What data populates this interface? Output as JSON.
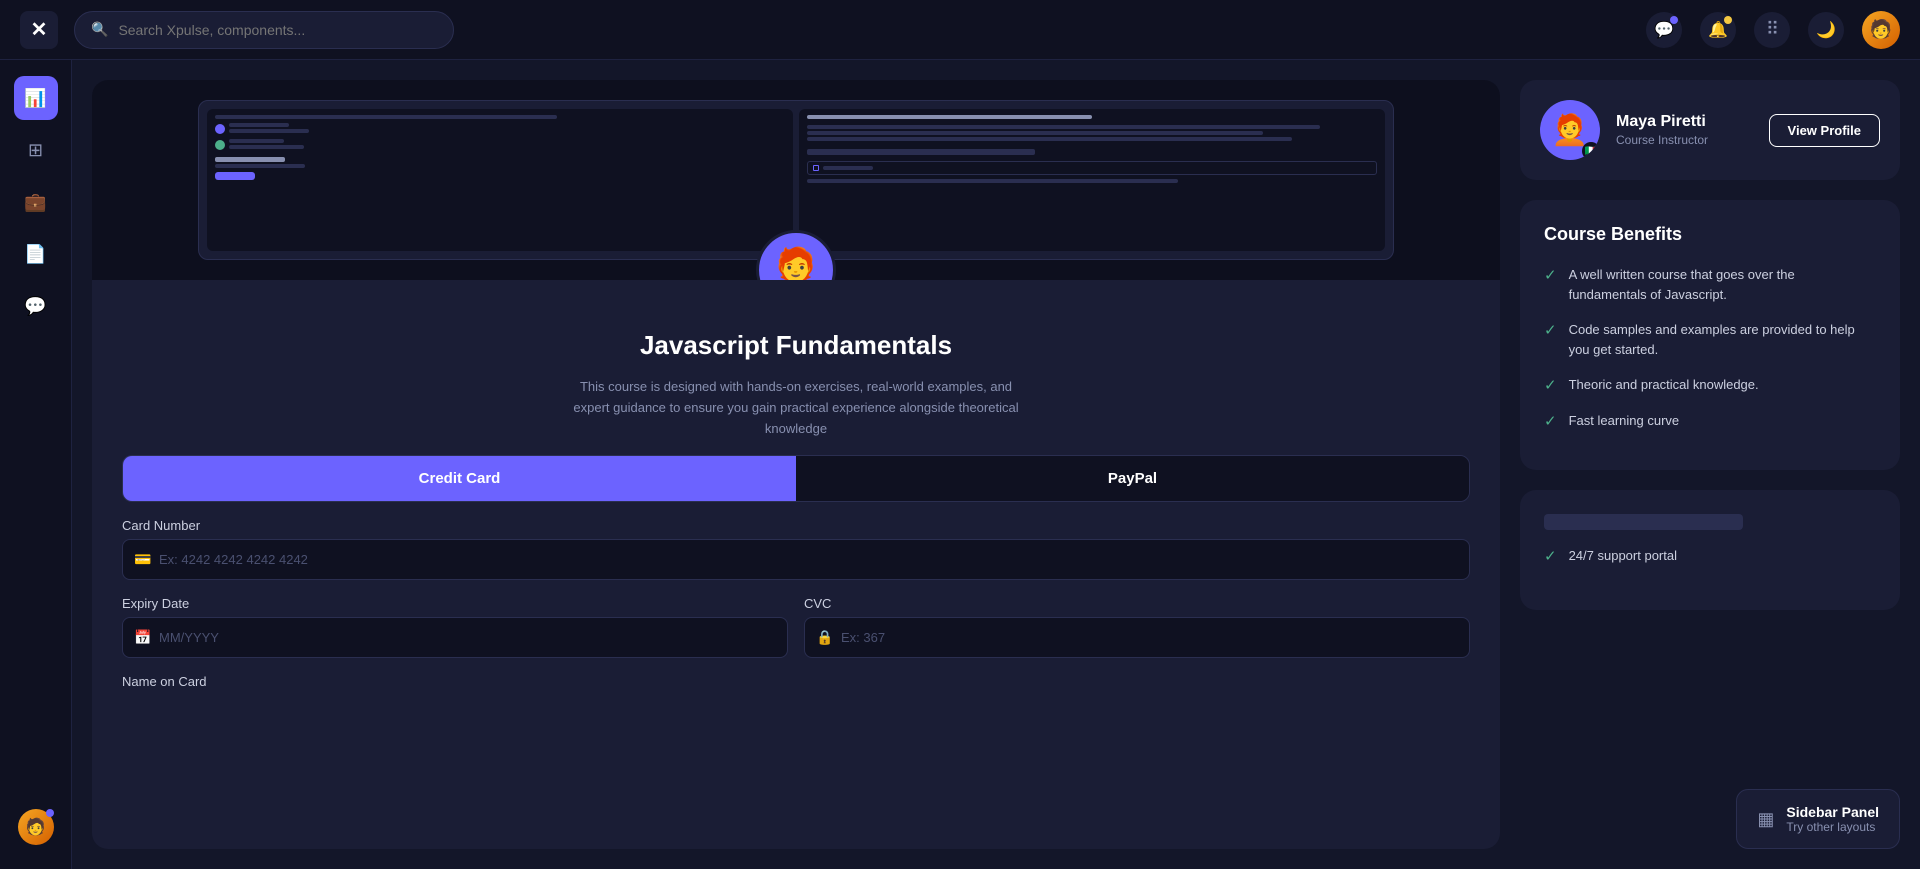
{
  "topnav": {
    "logo": "✕",
    "search_placeholder": "Search Xpulse, components...",
    "icons": {
      "chat_icon": "💬",
      "bell_icon": "🔔",
      "grid_icon": "⠿",
      "moon_icon": "🌙"
    }
  },
  "sidebar": {
    "items": [
      {
        "id": "dashboard",
        "icon": "📊",
        "active": true
      },
      {
        "id": "grid",
        "icon": "⊞",
        "active": false
      },
      {
        "id": "briefcase",
        "icon": "💼",
        "active": false
      },
      {
        "id": "file",
        "icon": "📄",
        "active": false
      },
      {
        "id": "message",
        "icon": "💬",
        "active": false
      }
    ]
  },
  "course": {
    "title": "Javascript Fundamentals",
    "description": "This course is designed with hands-on exercises, real-world examples, and expert guidance to ensure you gain practical experience alongside theoretical knowledge",
    "payment_tabs": [
      {
        "label": "Credit Card",
        "active": true
      },
      {
        "label": "PayPal",
        "active": false
      }
    ],
    "form": {
      "card_number_label": "Card Number",
      "card_number_placeholder": "Ex: 4242 4242 4242 4242",
      "expiry_label": "Expiry Date",
      "expiry_placeholder": "MM/YYYY",
      "cvc_label": "CVC",
      "cvc_placeholder": "Ex: 367",
      "name_label": "Name on Card"
    }
  },
  "instructor": {
    "name": "Maya Piretti",
    "role": "Course Instructor",
    "view_profile_label": "View Profile",
    "flag": "🇮🇹"
  },
  "benefits": {
    "title": "Course Benefits",
    "items": [
      "A well written course that goes over the fundamentals of Javascript.",
      "Code samples and examples are provided to help you get started.",
      "Theoric and practical knowledge.",
      "Fast learning curve"
    ]
  },
  "extra_card": {
    "benefit": "24/7 support portal"
  },
  "sidebar_panel": {
    "title": "Sidebar Panel",
    "subtitle": "Try other layouts",
    "icon": "▦"
  }
}
